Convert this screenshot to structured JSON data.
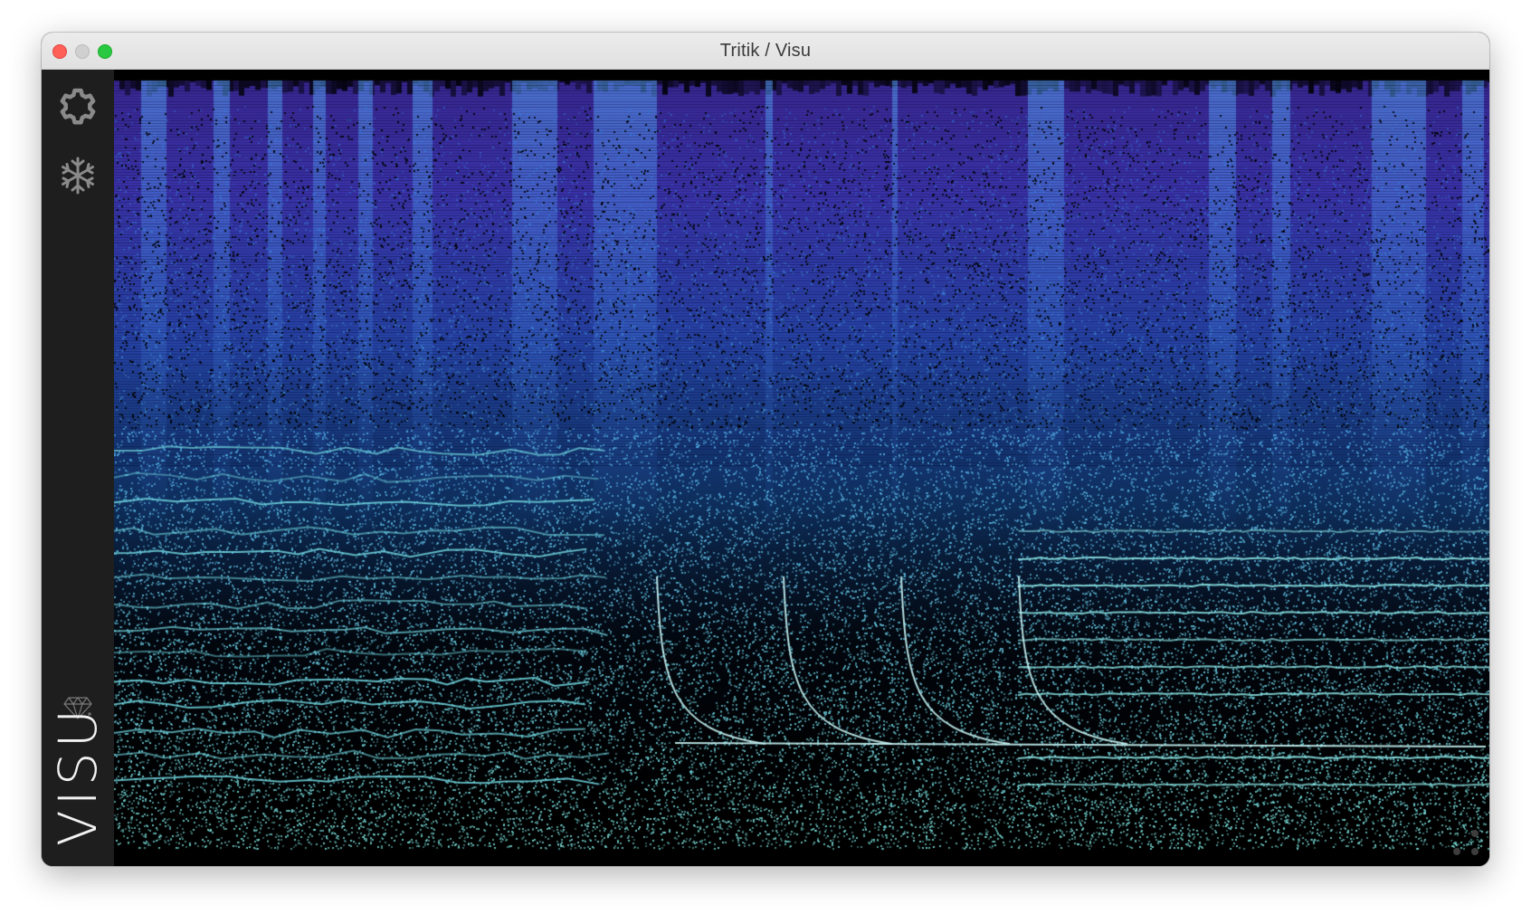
{
  "window": {
    "title": "Tritik / Visu"
  },
  "sidebar": {
    "icons": [
      "gear-icon",
      "snowflake-icon",
      "diamond-icon"
    ],
    "brand": "VISU"
  },
  "colors": {
    "background": "#000000",
    "sidebar": "#1e1e1e",
    "low_band": "#6fd0d8",
    "mid_band": "#2a8fe0",
    "high_band": "#5a4ae6",
    "dark_band": "#281060"
  }
}
